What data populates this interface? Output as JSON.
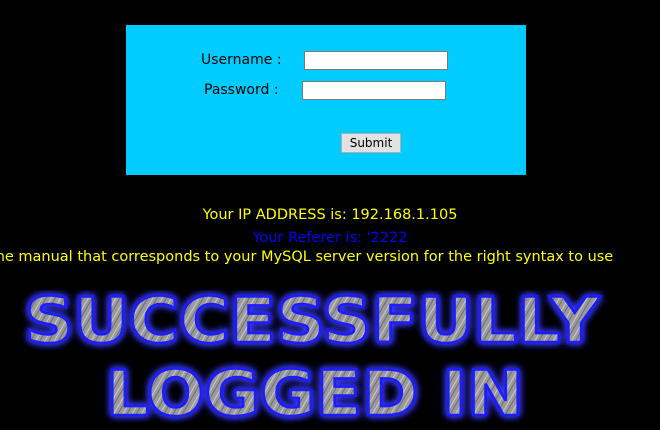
{
  "login_form": {
    "username_label": "Username :",
    "password_label": "Password :",
    "username_value": "",
    "password_value": "",
    "submit_label": "Submit",
    "background_color": "#00ccff"
  },
  "info": {
    "ip_line": "Your IP ADDRESS is: 192.168.1.105",
    "referer_line": "Your Referer is: '2222",
    "error_line": "k the manual that corresponds to your MySQL server version for the right syntax to use"
  },
  "banner": {
    "line1": "SUCCESSFULLY",
    "line2": "LOGGED IN"
  },
  "colors": {
    "page_background": "#000000",
    "info_text": "#ffff00",
    "referer_text": "#0000ff",
    "banner_glow": "#3a3aff"
  }
}
